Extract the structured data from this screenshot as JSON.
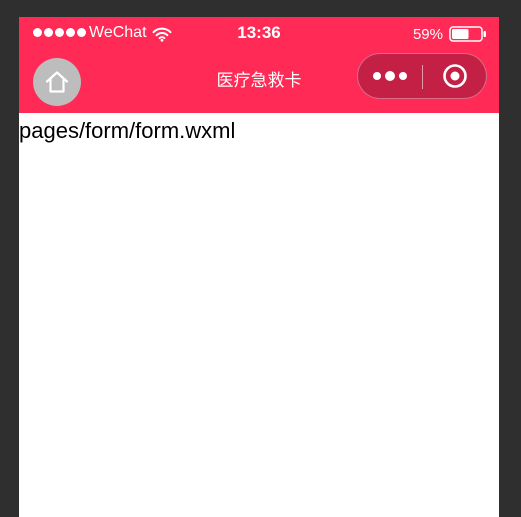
{
  "status_bar": {
    "carrier": "WeChat",
    "time": "13:36",
    "battery": "59%",
    "battery_level": 0.59
  },
  "nav_bar": {
    "title": "医疗急救卡"
  },
  "content": {
    "page_path": "pages/form/form.wxml"
  },
  "colors": {
    "brand": "#ff2a55",
    "capsule": "#c41f45",
    "home_button": "#bdbdbd",
    "background": "#2f2f2f"
  },
  "icons": {
    "home": "home-icon",
    "more": "more-dots-icon",
    "close": "target-circle-icon",
    "wifi": "wifi-icon",
    "battery": "battery-icon",
    "signal": "signal-dots-icon"
  }
}
